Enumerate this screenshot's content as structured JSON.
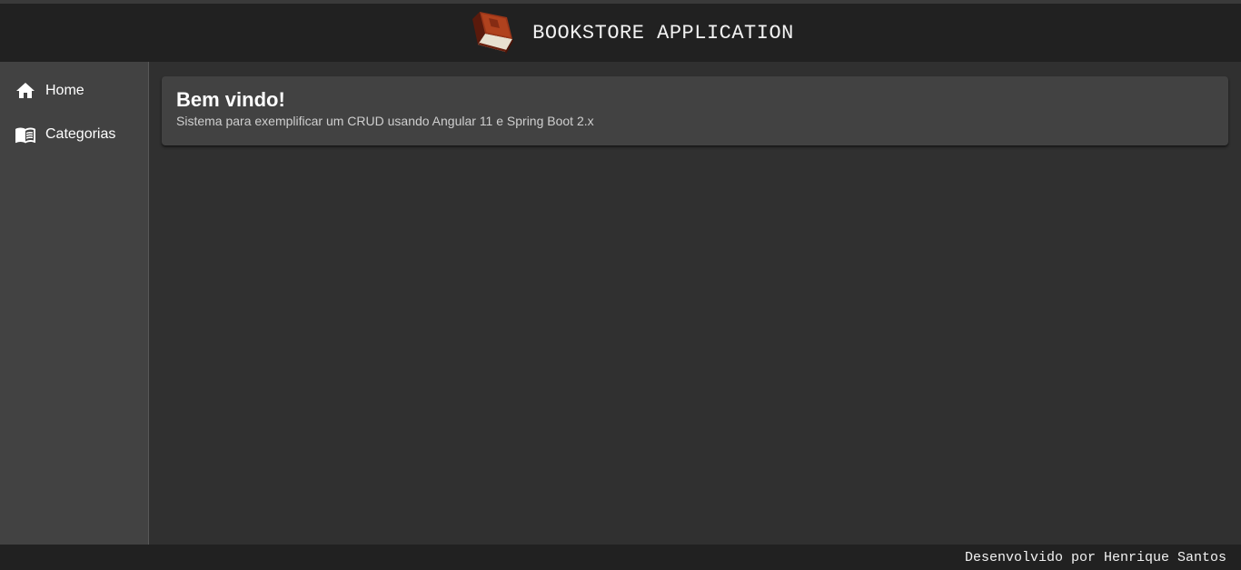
{
  "header": {
    "title": "BOOKSTORE APPLICATION",
    "logo_icon": "book-logo-icon"
  },
  "sidebar": {
    "items": [
      {
        "label": "Home",
        "icon": "home-icon"
      },
      {
        "label": "Categorias",
        "icon": "menu-book-icon"
      }
    ]
  },
  "main": {
    "card": {
      "title": "Bem vindo!",
      "subtitle": "Sistema para exemplificar um CRUD usando Angular 11 e Spring Boot 2.x"
    }
  },
  "footer": {
    "text": "Desenvolvido por Henrique Santos"
  },
  "colors": {
    "toolbar_bg": "#212121",
    "sidebar_bg": "#424242",
    "content_bg": "#303030",
    "card_bg": "#424242",
    "logo_book": "#8b2e16"
  }
}
